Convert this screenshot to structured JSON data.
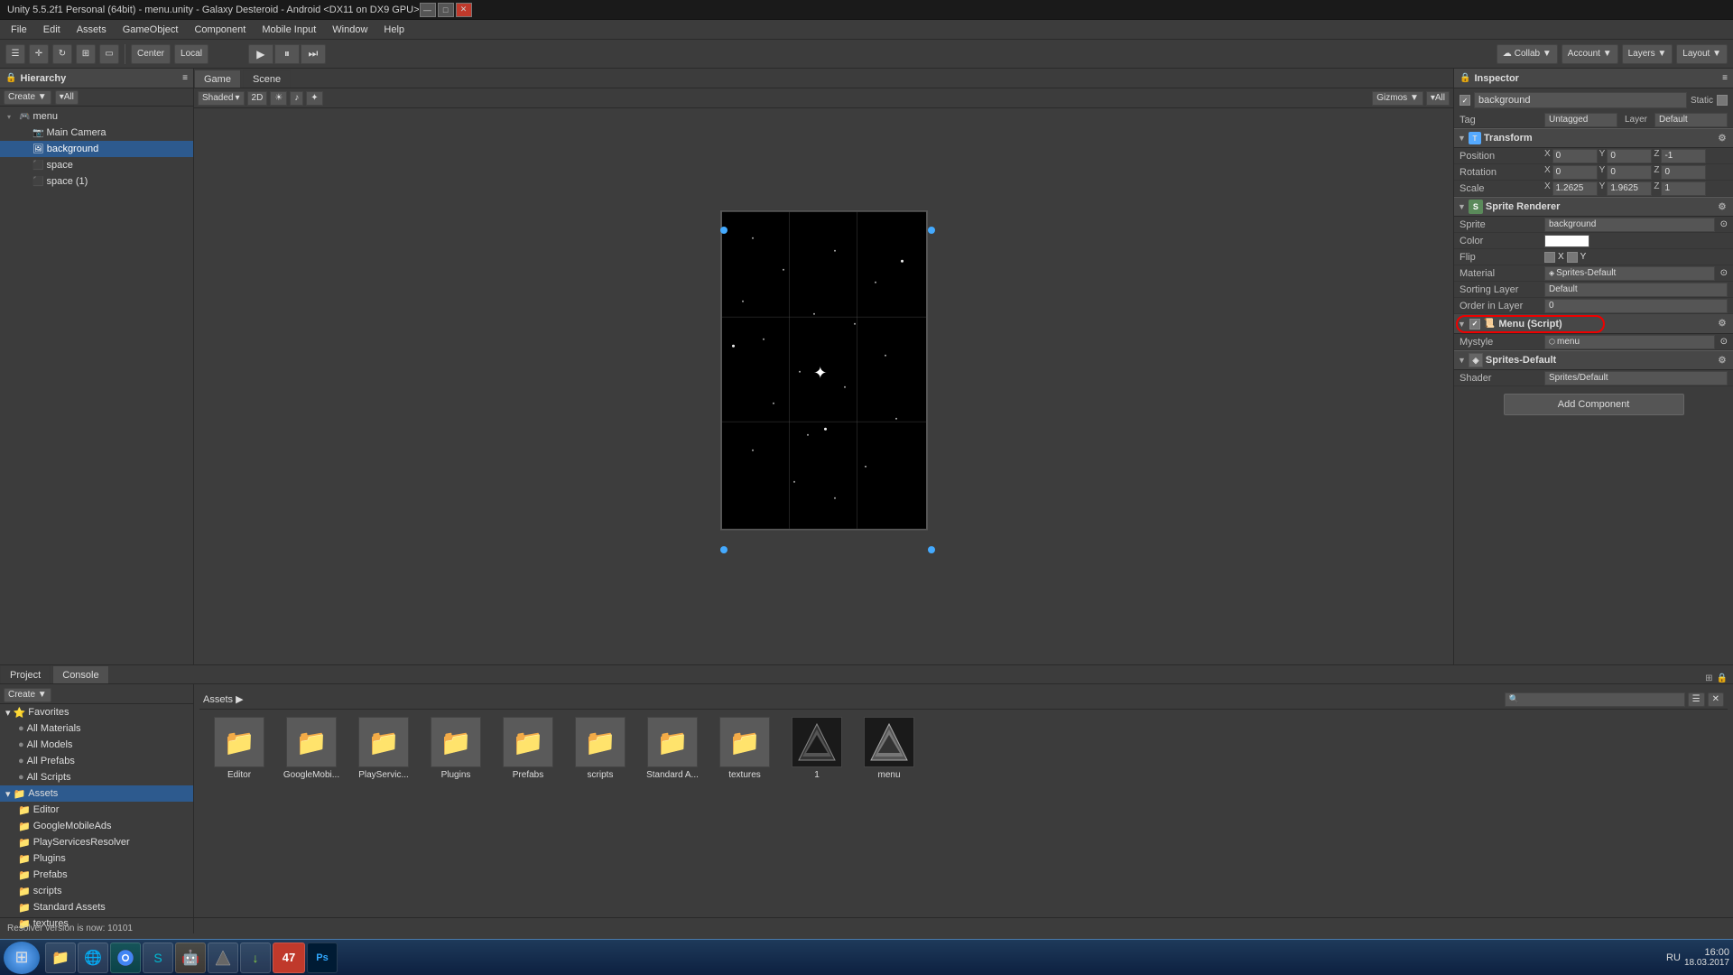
{
  "titleBar": {
    "title": "Unity 5.5.2f1 Personal (64bit) - menu.unity - Galaxy Desteroid - Android <DX11 on DX9 GPU>",
    "controls": [
      "—",
      "□",
      "✕"
    ]
  },
  "menuBar": {
    "items": [
      "File",
      "Edit",
      "Assets",
      "GameObject",
      "Component",
      "Mobile Input",
      "Window",
      "Help"
    ]
  },
  "toolbar": {
    "tools": [
      "⬡",
      "⬢",
      "⊞",
      "⊟",
      "⊠"
    ],
    "center": "Center",
    "local": "Local",
    "collab": "Collab ▼",
    "account": "Account ▼",
    "layers": "Layers ▼",
    "layout": "Layout ▼"
  },
  "hierarchy": {
    "title": "Hierarchy",
    "create_btn": "Create ▼",
    "all_btn": "▾All",
    "items": [
      {
        "label": "menu",
        "level": 0,
        "arrow": "▾",
        "id": "menu"
      },
      {
        "label": "Main Camera",
        "level": 1,
        "arrow": "",
        "id": "main-camera"
      },
      {
        "label": "background",
        "level": 1,
        "arrow": "",
        "id": "background",
        "selected": true
      },
      {
        "label": "space",
        "level": 1,
        "arrow": "",
        "id": "space"
      },
      {
        "label": "space (1)",
        "level": 1,
        "arrow": "",
        "id": "space1"
      }
    ]
  },
  "sceneView": {
    "tab": "Scene",
    "shading": "Shaded",
    "mode": "2D",
    "gizmos": "Gizmos ▼",
    "all": "▾All"
  },
  "gameView": {
    "tab": "Game"
  },
  "inspector": {
    "title": "Inspector",
    "objectName": "background",
    "tag": "Untagged",
    "layer": "Default",
    "static_label": "Static",
    "transform": {
      "label": "Transform",
      "position": {
        "x": "0",
        "y": "0",
        "z": "-1"
      },
      "rotation": {
        "x": "0",
        "y": "0",
        "z": "0"
      },
      "scale": {
        "x": "1.2625",
        "y": "1.9625",
        "z": "1"
      }
    },
    "spriteRenderer": {
      "label": "Sprite Renderer",
      "sprite": "background",
      "color": "",
      "flip": {
        "x": "X",
        "y": "Y"
      },
      "material": "Sprites-Default",
      "sortingLayer": "Default",
      "orderInLayer": "0"
    },
    "menuScript": {
      "label": "Menu (Script)",
      "mystyle": "menu"
    },
    "mystyle": {
      "label": "Mystyle"
    },
    "spritesDefault": {
      "label": "Sprites-Default",
      "shader": "Sprites/Default"
    },
    "addComponent": "Add Component"
  },
  "bottomPanel": {
    "tabs": [
      "Project",
      "Console"
    ],
    "activeTab": "Project",
    "create_btn": "Create ▼",
    "assets_label": "Assets ▶",
    "searchPlaceholder": ""
  },
  "projectSidebar": {
    "items": [
      {
        "label": "Favorites",
        "level": 0,
        "arrow": "▾"
      },
      {
        "label": "All Materials",
        "level": 1,
        "icon": "●"
      },
      {
        "label": "All Models",
        "level": 1,
        "icon": "●"
      },
      {
        "label": "All Prefabs",
        "level": 1,
        "icon": "●"
      },
      {
        "label": "All Scripts",
        "level": 1,
        "icon": "●"
      },
      {
        "label": "Assets",
        "level": 0,
        "arrow": "▾",
        "selected": true
      },
      {
        "label": "Editor",
        "level": 1,
        "icon": "📁"
      },
      {
        "label": "GoogleMobileAds",
        "level": 1,
        "icon": "📁"
      },
      {
        "label": "PlayServicesResolver",
        "level": 1,
        "icon": "📁"
      },
      {
        "label": "Plugins",
        "level": 1,
        "icon": "📁"
      },
      {
        "label": "Prefabs",
        "level": 1,
        "icon": "📁"
      },
      {
        "label": "scripts",
        "level": 1,
        "icon": "📁"
      },
      {
        "label": "Standard Assets",
        "level": 1,
        "icon": "📁"
      },
      {
        "label": "textures",
        "level": 1,
        "icon": "📁"
      }
    ]
  },
  "assets": {
    "items": [
      {
        "label": "Editor",
        "type": "folder"
      },
      {
        "label": "GoogleMobi...",
        "type": "folder"
      },
      {
        "label": "PlayServic...",
        "type": "folder"
      },
      {
        "label": "Plugins",
        "type": "folder"
      },
      {
        "label": "Prefabs",
        "type": "folder"
      },
      {
        "label": "scripts",
        "type": "folder"
      },
      {
        "label": "Standard A...",
        "type": "folder"
      },
      {
        "label": "textures",
        "type": "folder"
      },
      {
        "label": "1",
        "type": "unity"
      },
      {
        "label": "menu",
        "type": "unity"
      }
    ]
  },
  "statusBar": {
    "message": "Resolver version is now: 10101"
  },
  "taskbar": {
    "time": "16:00",
    "date": "18.03.2017",
    "locale": "RU",
    "apps": [
      "🪟",
      "📁",
      "🌐",
      "🟢",
      "🟡",
      "🎮",
      "♦",
      "🟣",
      "47",
      "Ps"
    ]
  }
}
